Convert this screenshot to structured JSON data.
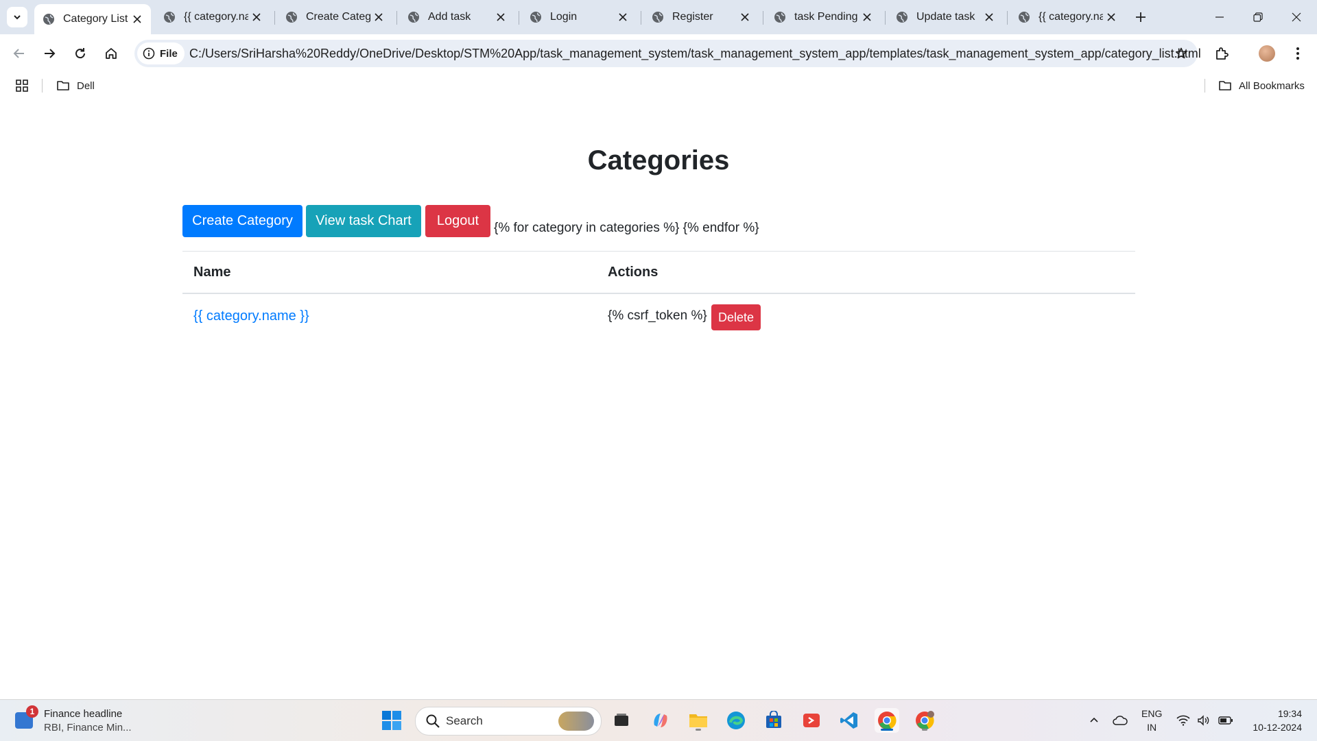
{
  "browser": {
    "tabs": [
      {
        "label": "Category List",
        "active": true
      },
      {
        "label": "{{ category.na"
      },
      {
        "label": "Create Categ"
      },
      {
        "label": "Add task"
      },
      {
        "label": "Login"
      },
      {
        "label": "Register"
      },
      {
        "label": "task Pending"
      },
      {
        "label": "Update task"
      },
      {
        "label": "{{ category.na"
      }
    ],
    "scheme_chip": "File",
    "url": "C:/Users/SriHarsha%20Reddy/OneDrive/Desktop/STM%20App/task_management_system/task_management_system_app/templates/task_management_system_app/category_list.html",
    "bookmarks": {
      "folder": "Dell",
      "all": "All Bookmarks"
    }
  },
  "page": {
    "title": "Categories",
    "buttons": {
      "create": "Create Category",
      "chart": "View task Chart",
      "logout": "Logout"
    },
    "loop_text": "{% for category in categories %} {% endfor %}",
    "table": {
      "headers": [
        "Name",
        "Actions"
      ],
      "rows": [
        {
          "name": "{{ category.name }}",
          "csrf": "{% csrf_token %}",
          "delete": "Delete"
        }
      ]
    }
  },
  "taskbar": {
    "widget": {
      "title": "Finance headline",
      "subtitle": "RBI, Finance Min...",
      "badge": "1"
    },
    "search_placeholder": "Search",
    "language": {
      "line1": "ENG",
      "line2": "IN"
    },
    "time": "19:34",
    "date": "10-12-2024"
  },
  "colors": {
    "primary": "#007bff",
    "info": "#17a2b8",
    "danger": "#dc3545",
    "link": "#007bff"
  }
}
